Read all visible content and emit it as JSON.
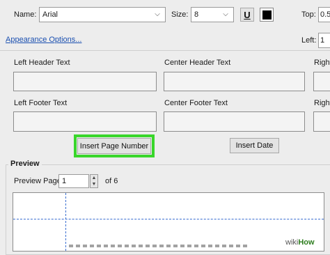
{
  "font": {
    "name_label": "Name:",
    "name_value": "Arial",
    "size_label": "Size:",
    "size_value": "8",
    "underline_icon": "U"
  },
  "margins": {
    "top_label": "Top:",
    "top_value": "0.5",
    "left_label": "Left:",
    "left_value": "1"
  },
  "appearance_link": "Appearance Options...",
  "fields": {
    "left_header": "Left Header Text",
    "center_header": "Center Header Text",
    "right_header": "Right",
    "left_footer": "Left Footer Text",
    "center_footer": "Center Footer Text",
    "right_footer": "Right"
  },
  "buttons": {
    "insert_page_number": "Insert Page Number",
    "insert_date": "Insert Date"
  },
  "preview": {
    "title": "Preview",
    "page_label": "Preview Page",
    "page_value": "1",
    "of_label": "of 6"
  },
  "watermark": {
    "wiki": "wiki",
    "how": "How"
  },
  "colors": {
    "highlight": "#39d62b",
    "guide_line": "#3b6fd1",
    "link": "#1a4fb0"
  }
}
